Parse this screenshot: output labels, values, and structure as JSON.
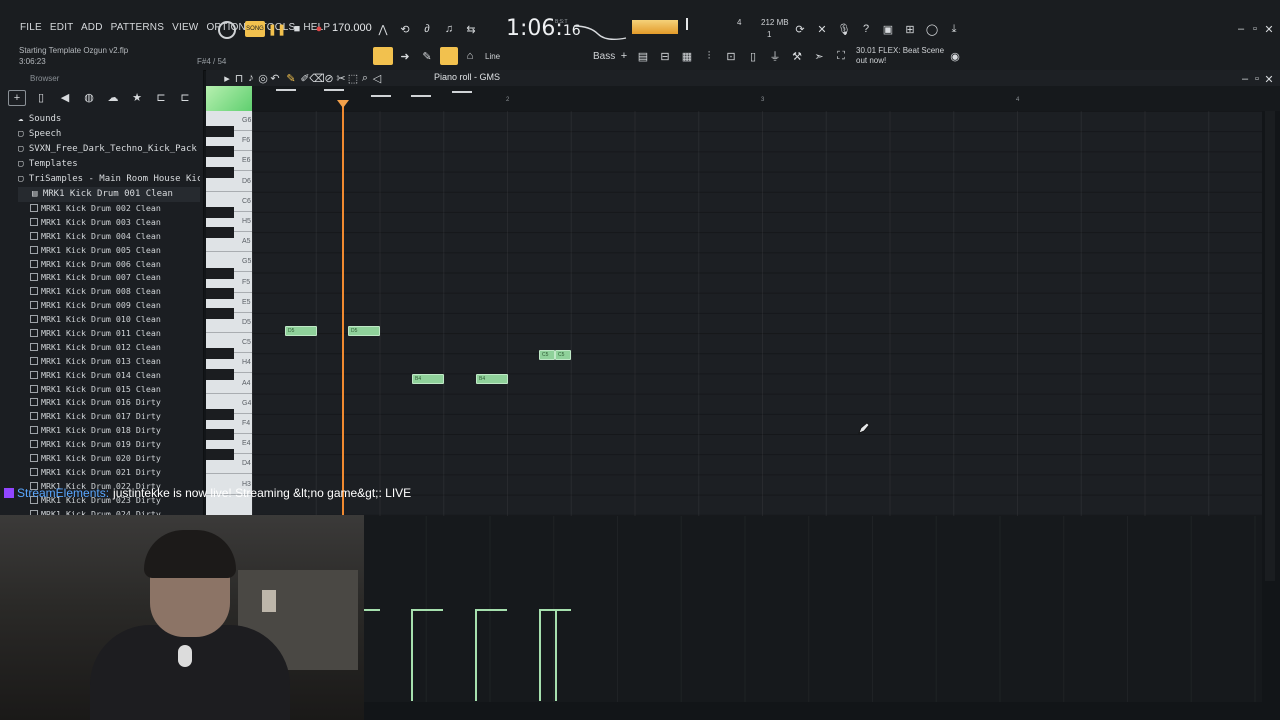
{
  "menu": [
    "FILE",
    "EDIT",
    "ADD",
    "PATTERNS",
    "VIEW",
    "OPTIONS",
    "TOOLS",
    "HELP"
  ],
  "transport": {
    "song_label": "SONG",
    "tempo": "170.000",
    "time": "1:06",
    "time_sub": "16",
    "time_unit": "B:S:T",
    "memory": "212 MB",
    "memory_sub": "1",
    "voices": "4"
  },
  "project": {
    "name": "Starting Template Ozgun v2.flp",
    "time": "3:06:23",
    "hint": "F#4 / 54"
  },
  "toolbar": {
    "snap": "Line",
    "pattern": "Bass"
  },
  "hint_panel": {
    "num": "30.01",
    "title": "FLEX: Beat Scene",
    "sub": "out now!"
  },
  "browser": {
    "title": "Browser",
    "folders": [
      "Sounds",
      "Speech",
      "SVXN_Free_Dark_Techno_Kick_Pack",
      "Templates",
      "TriSamples - Main Room House Kicks Vol 1",
      "MRK1 Kick Drum 001 Clean"
    ],
    "files": [
      "MRK1 Kick Drum 002 Clean",
      "MRK1 Kick Drum 003 Clean",
      "MRK1 Kick Drum 004 Clean",
      "MRK1 Kick Drum 005 Clean",
      "MRK1 Kick Drum 006 Clean",
      "MRK1 Kick Drum 007 Clean",
      "MRK1 Kick Drum 008 Clean",
      "MRK1 Kick Drum 009 Clean",
      "MRK1 Kick Drum 010 Clean",
      "MRK1 Kick Drum 011 Clean",
      "MRK1 Kick Drum 012 Clean",
      "MRK1 Kick Drum 013 Clean",
      "MRK1 Kick Drum 014 Clean",
      "MRK1 Kick Drum 015 Clean",
      "MRK1 Kick Drum 016 Dirty",
      "MRK1 Kick Drum 017 Dirty",
      "MRK1 Kick Drum 018 Dirty",
      "MRK1 Kick Drum 019 Dirty",
      "MRK1 Kick Drum 020 Dirty",
      "MRK1 Kick Drum 021 Dirty",
      "MRK1 Kick Drum 022 Dirty",
      "MRK1 Kick Drum 023 Dirty",
      "MRK1 Kick Drum 024 Dirty"
    ]
  },
  "piano_roll": {
    "title": "Piano roll - GMS",
    "bars": [
      "2",
      "3",
      "4"
    ],
    "key_labels": [
      "G6",
      "F6",
      "E6",
      "D6",
      "C6",
      "H5",
      "A5",
      "G5",
      "F5",
      "E5",
      "D5",
      "C5",
      "H4",
      "A4",
      "G4",
      "F4",
      "E4",
      "D4",
      "H3"
    ],
    "notes": [
      {
        "pitch": "D5",
        "label": "D5"
      },
      {
        "pitch": "D5",
        "label": "D5"
      },
      {
        "pitch": "A4",
        "label": "B4"
      },
      {
        "pitch": "A4",
        "label": "B4"
      },
      {
        "pitch": "C5",
        "label": "C5"
      },
      {
        "pitch": "C5",
        "label": "C5"
      }
    ]
  },
  "notification": {
    "who": "StreamElements:",
    "text": "justintekke is now live! Streaming &lt;no game&gt;: LIVE"
  },
  "colors": {
    "note": "#8fd19a",
    "playhead": "#f08a30",
    "accent": "#f2c14e"
  }
}
